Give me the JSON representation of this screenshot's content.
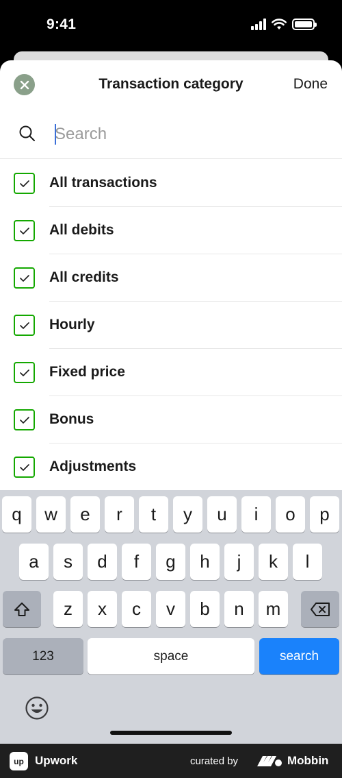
{
  "status_bar": {
    "time": "9:41"
  },
  "sheet": {
    "title": "Transaction category",
    "done_label": "Done"
  },
  "search": {
    "placeholder": "Search",
    "value": ""
  },
  "categories": [
    {
      "label": "All transactions",
      "checked": true
    },
    {
      "label": "All debits",
      "checked": true
    },
    {
      "label": "All credits",
      "checked": true
    },
    {
      "label": "Hourly",
      "checked": true
    },
    {
      "label": "Fixed price",
      "checked": true
    },
    {
      "label": "Bonus",
      "checked": true
    },
    {
      "label": "Adjustments",
      "checked": true
    }
  ],
  "keyboard": {
    "row1": [
      "q",
      "w",
      "e",
      "r",
      "t",
      "y",
      "u",
      "i",
      "o",
      "p"
    ],
    "row2": [
      "a",
      "s",
      "d",
      "f",
      "g",
      "h",
      "j",
      "k",
      "l"
    ],
    "row3": [
      "z",
      "x",
      "c",
      "v",
      "b",
      "n",
      "m"
    ],
    "numbers_label": "123",
    "space_label": "space",
    "return_label": "search"
  },
  "footer": {
    "app_name": "Upwork",
    "app_logo_text": "up",
    "curated_by": "curated by",
    "brand": "Mobbin"
  },
  "colors": {
    "accent_green": "#14a800",
    "keyboard_blue": "#1a82fb"
  }
}
